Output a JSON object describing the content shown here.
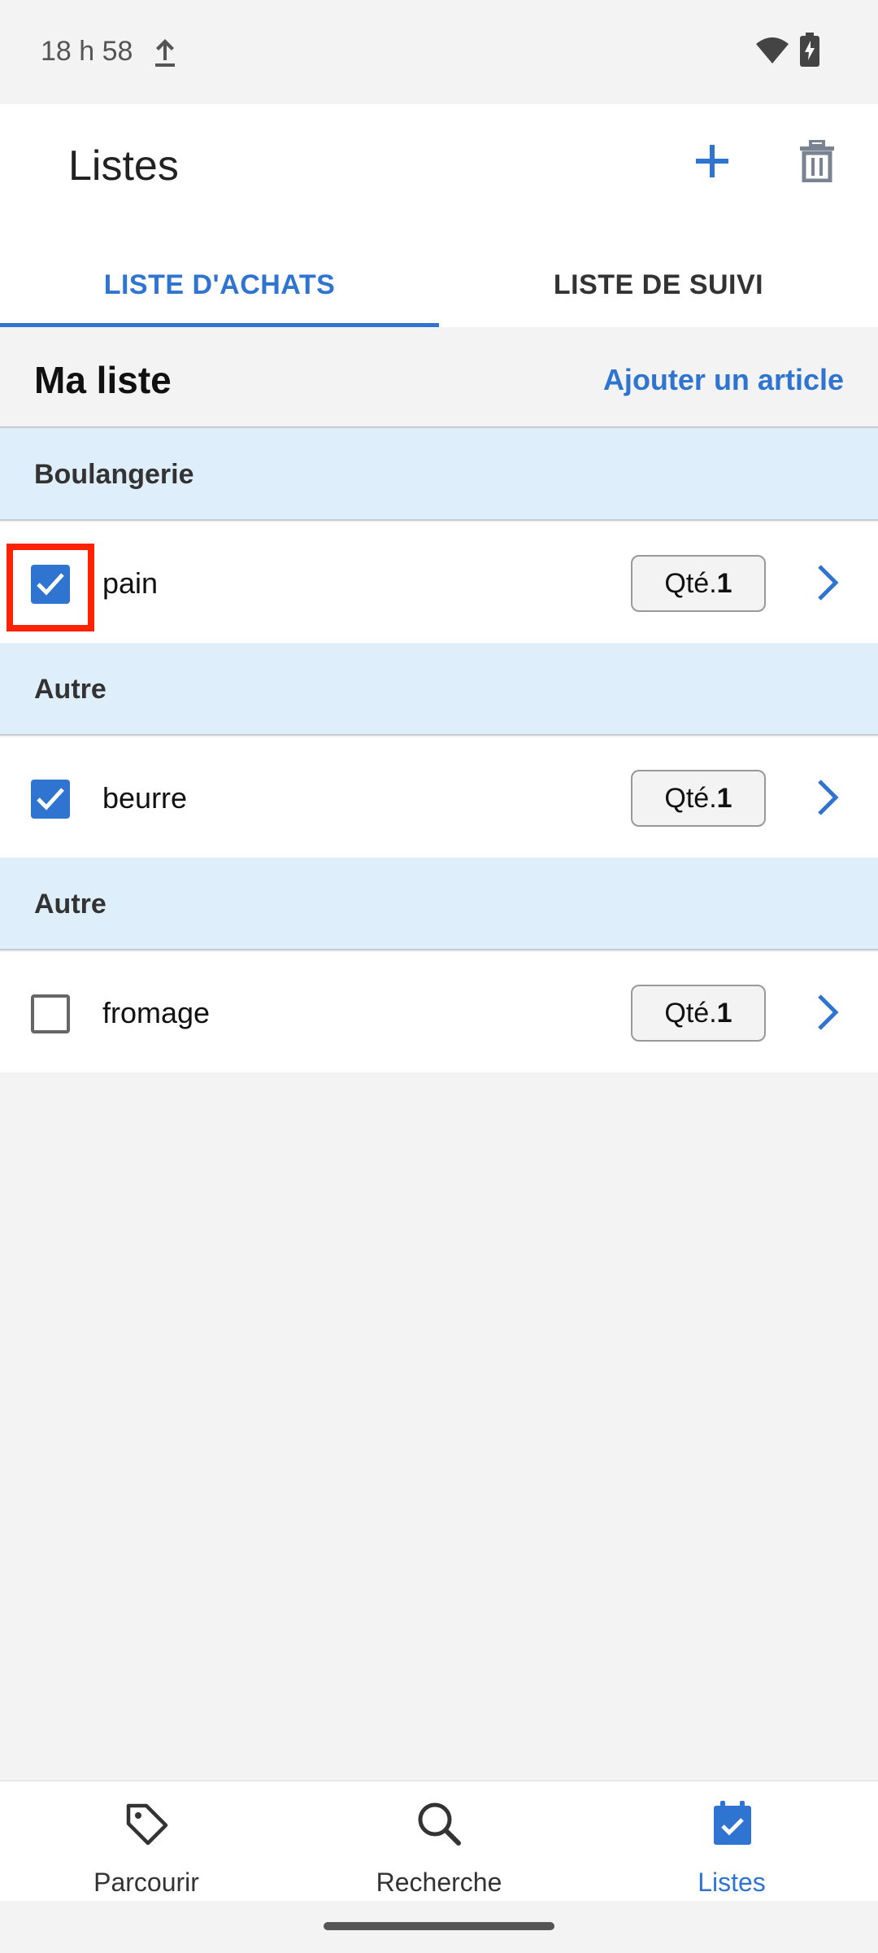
{
  "status_bar": {
    "time": "18 h 58"
  },
  "app_bar": {
    "title": "Listes"
  },
  "tabs": [
    {
      "label": "LISTE D'ACHATS",
      "active": true
    },
    {
      "label": "LISTE DE SUIVI",
      "active": false
    }
  ],
  "list_header": {
    "title": "Ma liste",
    "add_item_label": "Ajouter un article"
  },
  "sections": [
    {
      "label": "Boulangerie",
      "items": [
        {
          "name": "pain",
          "checked": true,
          "qty_label": "Qté.",
          "qty": "1"
        }
      ]
    },
    {
      "label": "Autre",
      "items": [
        {
          "name": "beurre",
          "checked": true,
          "qty_label": "Qté.",
          "qty": "1"
        }
      ]
    },
    {
      "label": "Autre",
      "items": [
        {
          "name": "fromage",
          "checked": false,
          "qty_label": "Qté.",
          "qty": "1"
        }
      ]
    }
  ],
  "bottom_nav": [
    {
      "label": "Parcourir",
      "icon": "tag-icon",
      "active": false
    },
    {
      "label": "Recherche",
      "icon": "search-icon",
      "active": false
    },
    {
      "label": "Listes",
      "icon": "checklist-icon",
      "active": true
    }
  ],
  "colors": {
    "accent": "#2f74d0",
    "section_bg": "#dfeefb",
    "page_bg": "#f3f3f3",
    "highlight": "#ff2200"
  }
}
